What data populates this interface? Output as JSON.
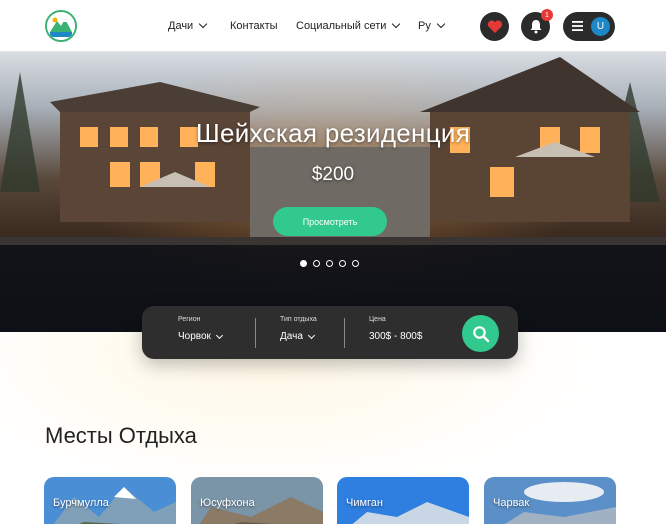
{
  "header": {
    "logo_name": "mountain-logo",
    "nav": {
      "dachi": "Дачи",
      "contacts": "Контакты",
      "social": "Социальный сети",
      "lang": "Ру"
    },
    "notification_count": "1",
    "avatar_letter": "U"
  },
  "hero": {
    "title": "Шейхская резиденция",
    "price": "$200",
    "button": "Просмотреть",
    "slides_total": 5,
    "active_slide": 1
  },
  "search": {
    "region": {
      "label": "Регион",
      "value": "Чорвок"
    },
    "rest_type": {
      "label": "Тип отдыха",
      "value": "Дача"
    },
    "price": {
      "label": "Цена",
      "value": "300$ - 800$"
    }
  },
  "section": {
    "title": "Месты Отдыха",
    "cards": [
      {
        "name": "Бурчмулла"
      },
      {
        "name": "Юсуфхона"
      },
      {
        "name": "Чимган"
      },
      {
        "name": "Чарвак"
      }
    ]
  },
  "colors": {
    "accent": "#32c98e",
    "dark": "#2b2b2b",
    "badge": "#e53935",
    "avatar": "#1e88c7"
  }
}
